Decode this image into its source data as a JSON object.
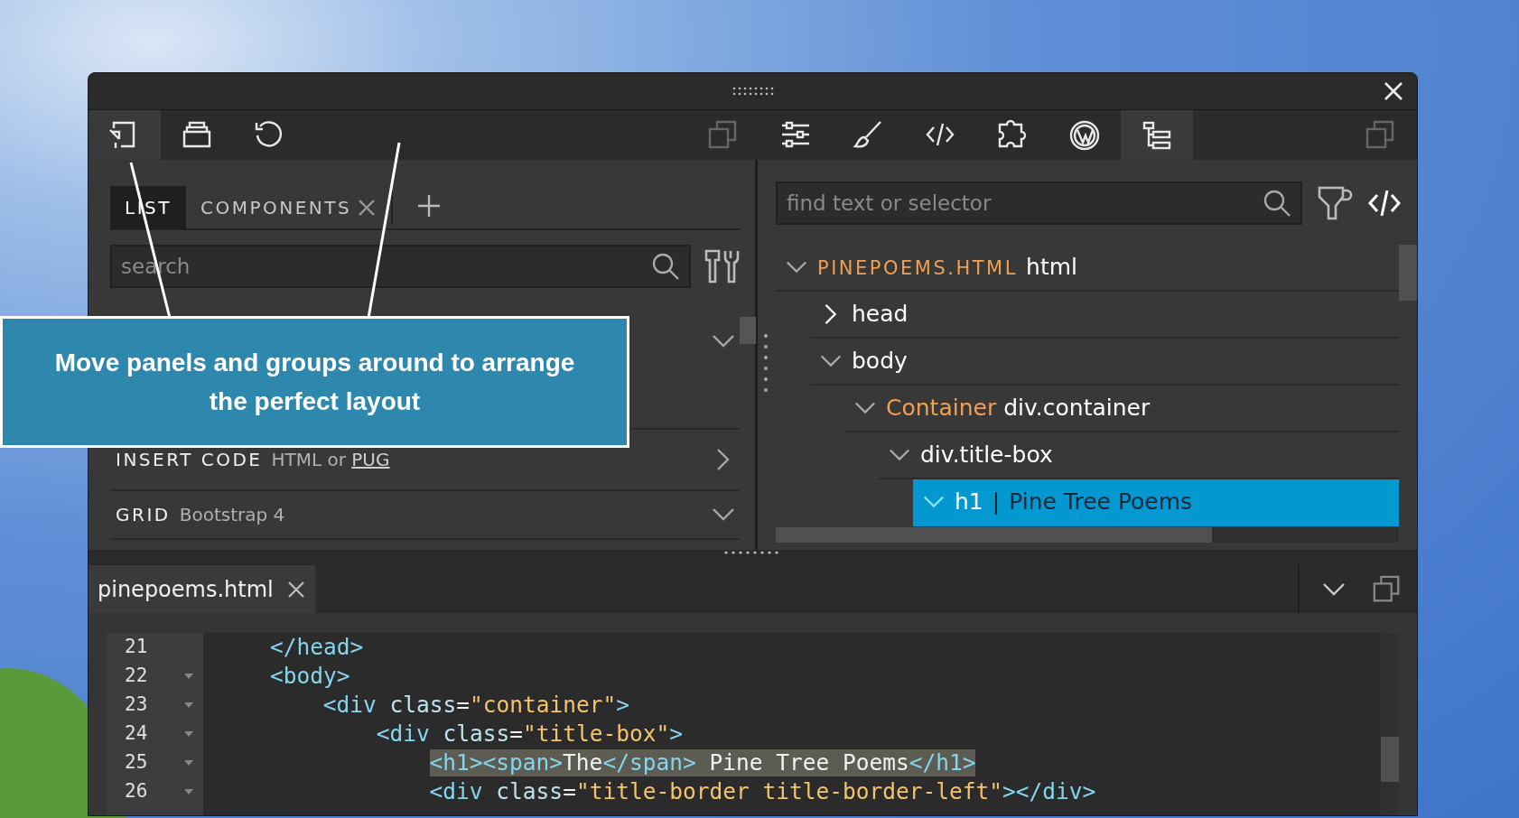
{
  "toolbar": {
    "left": [
      {
        "kind": "import",
        "selected": true
      },
      {
        "kind": "box",
        "selected": false
      },
      {
        "kind": "undo",
        "selected": false
      }
    ],
    "right": [
      {
        "kind": "duplicate",
        "selected": false
      },
      {
        "kind": "sliders",
        "selected": false
      },
      {
        "kind": "brush",
        "selected": false
      },
      {
        "kind": "code",
        "selected": false
      },
      {
        "kind": "puzzle",
        "selected": false
      },
      {
        "kind": "wordpress",
        "selected": false
      },
      {
        "kind": "tree",
        "selected": true
      }
    ]
  },
  "left_panel": {
    "tabs": [
      {
        "label": "LIST",
        "selected": true,
        "closable": false
      },
      {
        "label": "COMPONENTS",
        "selected": false,
        "closable": true
      }
    ],
    "search": {
      "placeholder": "search"
    },
    "sections": [
      {
        "expanded": true
      },
      {
        "title": "INSERT CODE",
        "subtitle": "HTML or ",
        "link": "PUG",
        "expanded": false
      },
      {
        "title": "GRID",
        "subtitle": "Bootstrap 4",
        "expanded": true
      }
    ]
  },
  "callout": {
    "text": "Move panels and groups around to arrange the perfect layout"
  },
  "right_panel": {
    "search": {
      "placeholder": "find text or selector"
    },
    "tree": [
      {
        "kind": "file",
        "prefix": "PINEPOEMS.HTML",
        "label": "html",
        "expanded": true,
        "selected": false,
        "children": [
          {
            "label": "head",
            "expanded": false,
            "selected": false
          },
          {
            "label": "body",
            "expanded": true,
            "selected": false,
            "children": [
              {
                "kind": "component",
                "prefix": "Container",
                "label": "div.container",
                "expanded": true,
                "selected": false,
                "children": [
                  {
                    "label": "div.title-box",
                    "expanded": true,
                    "selected": false,
                    "children": [
                      {
                        "label": "h1",
                        "separator": "|",
                        "content": "Pine Tree Poems",
                        "expanded": true,
                        "selected": true
                      }
                    ]
                  }
                ]
              }
            ]
          }
        ]
      }
    ]
  },
  "editor": {
    "tabs": [
      {
        "label": "pinepoems.html",
        "selected": true
      }
    ],
    "lines": [
      {
        "number": "21",
        "foldable": false,
        "highlighted": false,
        "tokens": [
          {
            "kind": "tag",
            "s": "</head>"
          }
        ]
      },
      {
        "number": "22",
        "foldable": true,
        "highlighted": false,
        "tokens": [
          {
            "kind": "tag",
            "s": "<body>"
          }
        ],
        "children": [
          {
            "number": "23",
            "foldable": true,
            "highlighted": false,
            "tokens": [
              {
                "kind": "tag",
                "s": "<div"
              },
              {
                "kind": "attr",
                "s": " class"
              },
              {
                "kind": "text",
                "s": "="
              },
              {
                "kind": "value",
                "s": "\"container\""
              },
              {
                "kind": "tag",
                "s": ">"
              }
            ],
            "children": [
              {
                "number": "24",
                "foldable": true,
                "highlighted": false,
                "tokens": [
                  {
                    "kind": "tag",
                    "s": "<div"
                  },
                  {
                    "kind": "attr",
                    "s": " class"
                  },
                  {
                    "kind": "text",
                    "s": "="
                  },
                  {
                    "kind": "value",
                    "s": "\"title-box\""
                  },
                  {
                    "kind": "tag",
                    "s": ">"
                  }
                ],
                "children": [
                  {
                    "number": "25",
                    "foldable": true,
                    "highlighted": true,
                    "tokens": [
                      {
                        "kind": "tag",
                        "s": "<h1><span>"
                      },
                      {
                        "kind": "text",
                        "s": "The"
                      },
                      {
                        "kind": "tag",
                        "s": "</span>"
                      },
                      {
                        "kind": "text",
                        "s": " Pine Tree Poems"
                      },
                      {
                        "kind": "tag",
                        "s": "</h1>"
                      }
                    ]
                  },
                  {
                    "number": "26",
                    "foldable": true,
                    "highlighted": false,
                    "tokens": [
                      {
                        "kind": "tag",
                        "s": "<div"
                      },
                      {
                        "kind": "attr",
                        "s": " class"
                      },
                      {
                        "kind": "text",
                        "s": "="
                      },
                      {
                        "kind": "value",
                        "s": "\"title-border title-border-left\""
                      },
                      {
                        "kind": "tag",
                        "s": "></div>"
                      }
                    ]
                  }
                ]
              }
            ]
          }
        ]
      }
    ]
  }
}
